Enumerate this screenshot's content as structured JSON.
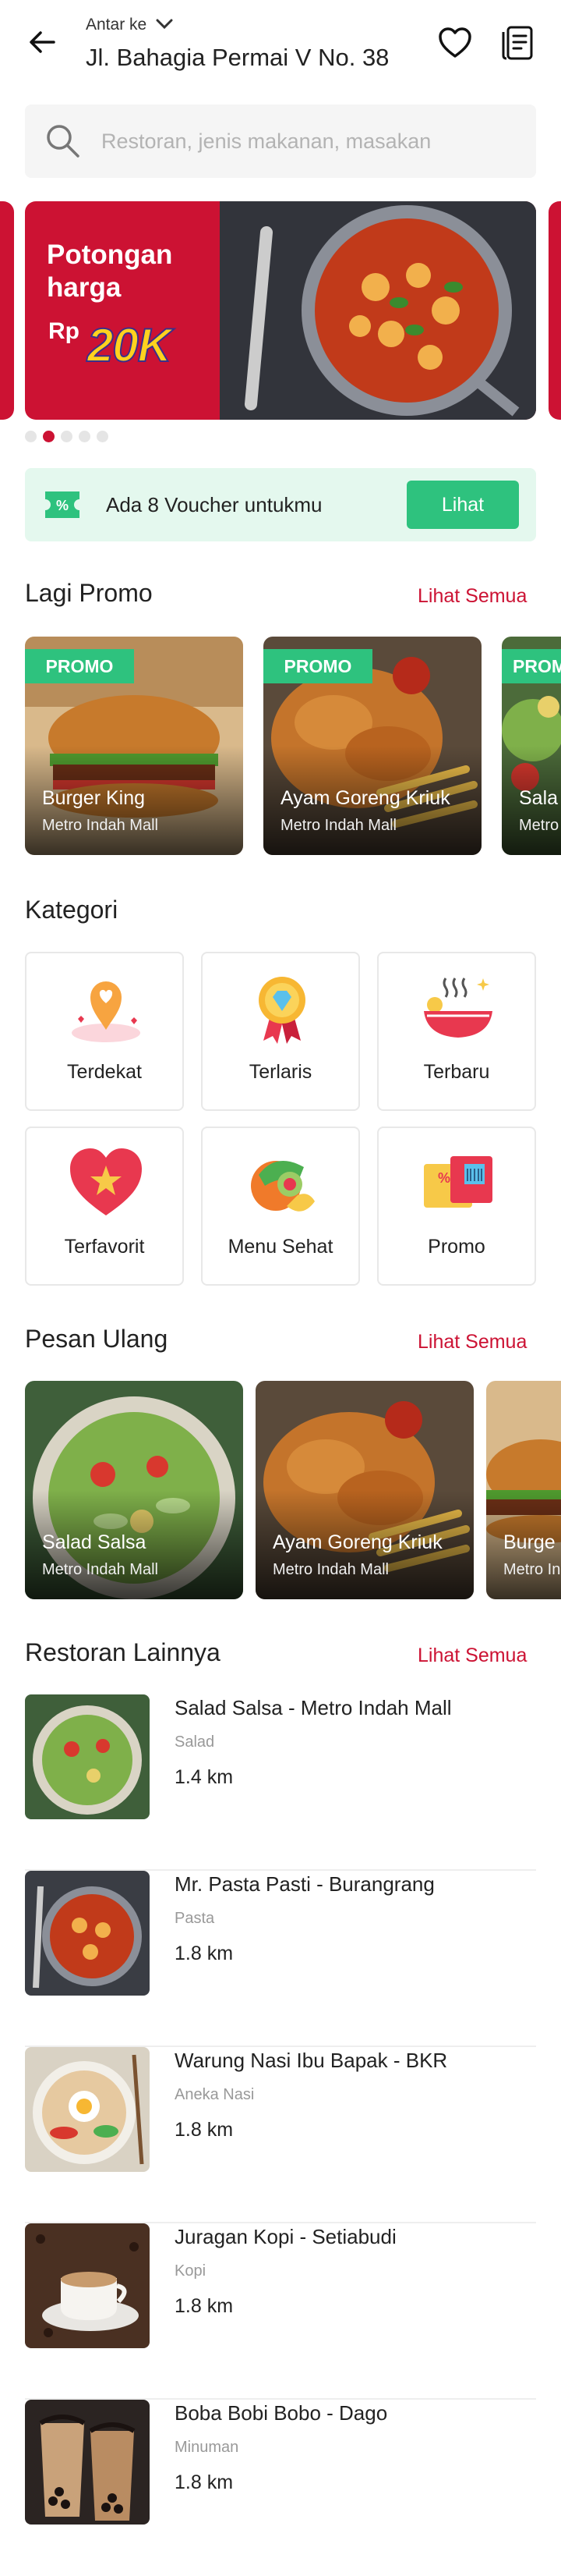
{
  "header": {
    "deliver_label": "Antar ke",
    "address": "Jl. Bahagia Permai V No. 38"
  },
  "search": {
    "placeholder": "Restoran, jenis makanan, masakan"
  },
  "banner": {
    "title": "Potongan harga",
    "currency": "Rp",
    "amount": "20K",
    "slides": 5,
    "active_slide": 2
  },
  "voucher": {
    "text": "Ada 8 Voucher untukmu",
    "button": "Lihat"
  },
  "promo_section": {
    "title": "Lagi Promo",
    "link": "Lihat Semua",
    "items": [
      {
        "tag": "PROMO",
        "name": "Burger King",
        "location": "Metro Indah Mall"
      },
      {
        "tag": "PROMO",
        "name": "Ayam Goreng Kriuk",
        "location": "Metro Indah Mall"
      },
      {
        "tag": "PROM",
        "name": "Sala",
        "location": "Metro"
      }
    ]
  },
  "category_section": {
    "title": "Kategori",
    "items": [
      {
        "label": "Terdekat",
        "icon": "location-heart-icon"
      },
      {
        "label": "Terlaris",
        "icon": "medal-icon"
      },
      {
        "label": "Terbaru",
        "icon": "fresh-bowl-icon"
      },
      {
        "label": "Terfavorit",
        "icon": "heart-star-icon"
      },
      {
        "label": "Menu Sehat",
        "icon": "healthy-fruit-icon"
      },
      {
        "label": "Promo",
        "icon": "coupon-icon"
      }
    ]
  },
  "reorder_section": {
    "title": "Pesan Ulang",
    "link": "Lihat Semua",
    "items": [
      {
        "name": "Salad Salsa",
        "location": "Metro Indah Mall"
      },
      {
        "name": "Ayam Goreng Kriuk",
        "location": "Metro Indah Mall"
      },
      {
        "name": "Burge",
        "location": "Metro In"
      }
    ]
  },
  "other_section": {
    "title": "Restoran Lainnya",
    "link": "Lihat Semua",
    "items": [
      {
        "name": "Salad Salsa - Metro Indah Mall",
        "category": "Salad",
        "distance": "1.4 km"
      },
      {
        "name": "Mr. Pasta Pasti - Burangrang",
        "category": "Pasta",
        "distance": "1.8 km"
      },
      {
        "name": "Warung Nasi Ibu Bapak - BKR",
        "category": "Aneka Nasi",
        "distance": "1.8 km"
      },
      {
        "name": "Juragan Kopi - Setiabudi",
        "category": "Kopi",
        "distance": "1.8 km"
      },
      {
        "name": "Boba Bobi Bobo - Dago",
        "category": "Minuman",
        "distance": "1.8 km"
      }
    ]
  },
  "colors": {
    "brand_red": "#cc1233",
    "promo_green": "#2ec27e",
    "voucher_bg": "#e4f8ee"
  }
}
